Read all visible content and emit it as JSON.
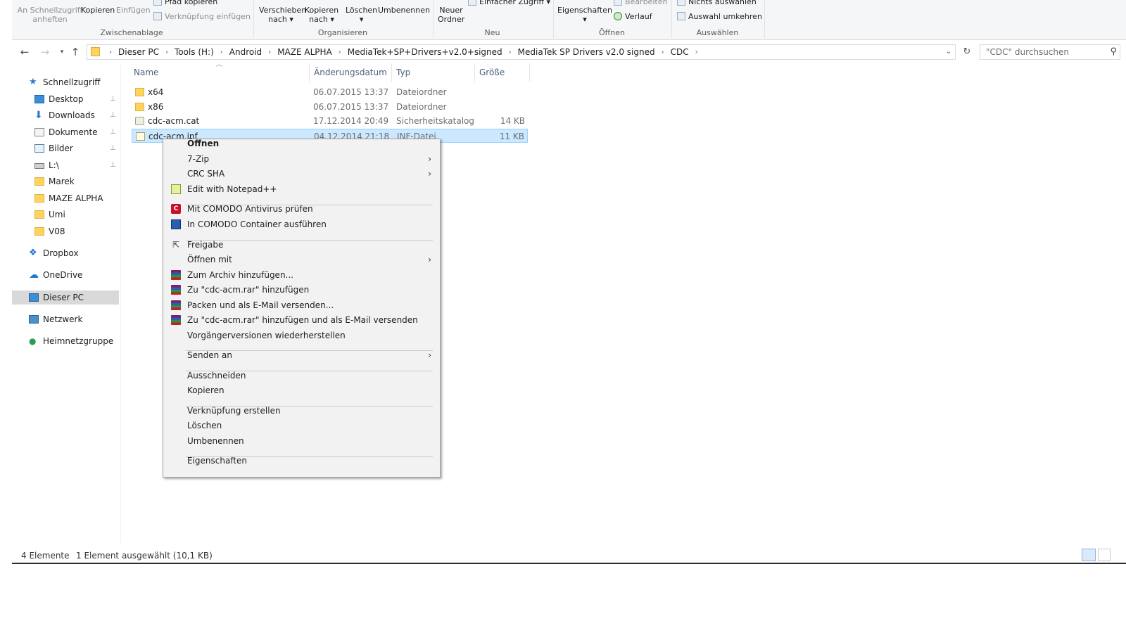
{
  "ribbon": {
    "clipboard": {
      "pin_label": "An Schnellzugriff anheften",
      "copy_label": "Kopieren",
      "paste_label": "Einfügen",
      "copy_path_label": "Pfad kopieren",
      "paste_shortcut_label": "Verknüpfung einfügen",
      "group_label": "Zwischenablage"
    },
    "organize": {
      "move_label": "Verschieben nach",
      "copy_to_label": "Kopieren nach",
      "delete_label": "Löschen",
      "rename_label": "Umbenennen",
      "group_label": "Organisieren"
    },
    "new": {
      "new_folder_label": "Neuer Ordner",
      "easy_access_label": "Einfacher Zugriff",
      "group_label": "Neu"
    },
    "open": {
      "properties_label": "Eigenschaften",
      "edit_label": "Bearbeiten",
      "history_label": "Verlauf",
      "group_label": "Öffnen"
    },
    "select": {
      "select_none_label": "Nichts auswählen",
      "invert_label": "Auswahl umkehren",
      "group_label": "Auswählen"
    }
  },
  "address_bar": {
    "crumbs": [
      "Dieser PC",
      "Tools (H:)",
      "Android",
      "MAZE ALPHA",
      "MediaTek+SP+Drivers+v2.0+signed",
      "MediaTek SP Drivers v2.0 signed",
      "CDC"
    ],
    "search_placeholder": "\"CDC\" durchsuchen"
  },
  "nav_pane": {
    "items": [
      {
        "label": "Schnellzugriff",
        "icon": "star-icon"
      },
      {
        "label": "Desktop",
        "icon": "desktop-icon",
        "pinned": true
      },
      {
        "label": "Downloads",
        "icon": "download-icon",
        "pinned": true
      },
      {
        "label": "Dokumente",
        "icon": "document-icon",
        "pinned": true
      },
      {
        "label": "Bilder",
        "icon": "pictures-icon",
        "pinned": true
      },
      {
        "label": "L:\\",
        "icon": "network-drive-icon",
        "pinned": true
      },
      {
        "label": "Marek",
        "icon": "folder-icon"
      },
      {
        "label": "MAZE ALPHA",
        "icon": "folder-icon"
      },
      {
        "label": "Umi",
        "icon": "folder-icon"
      },
      {
        "label": "V08",
        "icon": "folder-icon"
      },
      {
        "label": "Dropbox",
        "icon": "dropbox-icon"
      },
      {
        "label": "OneDrive",
        "icon": "cloud-icon"
      },
      {
        "label": "Dieser PC",
        "icon": "computer-icon",
        "selected": true
      },
      {
        "label": "Netzwerk",
        "icon": "network-icon"
      },
      {
        "label": "Heimnetzgruppe",
        "icon": "homegroup-icon"
      }
    ]
  },
  "file_list": {
    "columns": [
      "Name",
      "Änderungsdatum",
      "Typ",
      "Größe"
    ],
    "rows": [
      {
        "name": "x64",
        "date": "06.07.2015 13:37",
        "type": "Dateiordner",
        "size": "",
        "icon": "folder-icon"
      },
      {
        "name": "x86",
        "date": "06.07.2015 13:37",
        "type": "Dateiordner",
        "size": "",
        "icon": "folder-icon"
      },
      {
        "name": "cdc-acm.cat",
        "date": "17.12.2014 20:49",
        "type": "Sicherheitskatalog",
        "size": "14 KB",
        "icon": "certificate-icon"
      },
      {
        "name": "cdc-acm.inf",
        "date": "04.12.2014 21:18",
        "type": "INF-Datei",
        "size": "11 KB",
        "icon": "inf-file-icon",
        "selected": true
      }
    ]
  },
  "status_bar": {
    "count": "4 Elemente",
    "selection": "1 Element ausgewählt (10,1 KB)"
  },
  "context_menu": {
    "items": [
      {
        "label": "Öffnen",
        "bold": true
      },
      {
        "label": "7-Zip",
        "submenu": true
      },
      {
        "label": "CRC SHA",
        "submenu": true
      },
      {
        "label": "Edit with Notepad++",
        "icon": "notepadpp-icon"
      },
      {
        "label": "Mit COMODO Antivirus prüfen",
        "icon": "comodo-antivirus-icon"
      },
      {
        "label": "In COMODO Container ausführen",
        "icon": "comodo-container-icon"
      },
      {
        "label": "Freigabe",
        "icon": "share-icon"
      },
      {
        "label": "Öffnen mit",
        "submenu": true
      },
      {
        "label": "Zum Archiv hinzufügen...",
        "icon": "winrar-icon"
      },
      {
        "label": "Zu \"cdc-acm.rar\" hinzufügen",
        "icon": "winrar-icon"
      },
      {
        "label": "Packen und als E-Mail versenden...",
        "icon": "winrar-icon"
      },
      {
        "label": "Zu \"cdc-acm.rar\" hinzufügen und als E-Mail versenden",
        "icon": "winrar-icon"
      },
      {
        "label": "Vorgängerversionen wiederherstellen"
      },
      {
        "label": "Senden an",
        "submenu": true
      },
      {
        "label": "Ausschneiden"
      },
      {
        "label": "Kopieren"
      },
      {
        "label": "Verknüpfung erstellen"
      },
      {
        "label": "Löschen"
      },
      {
        "label": "Umbenennen"
      },
      {
        "label": "Eigenschaften"
      }
    ]
  }
}
